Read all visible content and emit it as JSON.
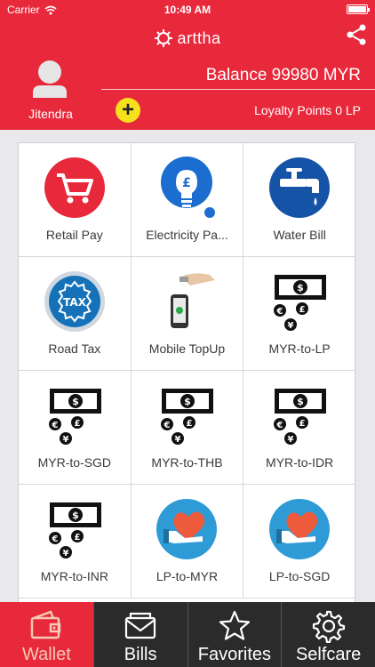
{
  "status_bar": {
    "carrier": "Carrier",
    "time": "10:49 AM"
  },
  "header": {
    "brand": "arttha",
    "user_name": "Jitendra",
    "balance": "Balance 99980 MYR",
    "loyalty": "Loyalty Points 0 LP",
    "add_label": "+"
  },
  "services": [
    {
      "label": "Retail Pay",
      "icon": "cart-icon"
    },
    {
      "label": "Electricity Pa...",
      "icon": "bulb-icon"
    },
    {
      "label": "Water Bill",
      "icon": "tap-icon"
    },
    {
      "label": "Road Tax",
      "icon": "tax-icon"
    },
    {
      "label": "Mobile TopUp",
      "icon": "phone-topup-icon"
    },
    {
      "label": "MYR-to-LP",
      "icon": "currency-exchange-icon"
    },
    {
      "label": "MYR-to-SGD",
      "icon": "currency-exchange-icon"
    },
    {
      "label": "MYR-to-THB",
      "icon": "currency-exchange-icon"
    },
    {
      "label": "MYR-to-IDR",
      "icon": "currency-exchange-icon"
    },
    {
      "label": "MYR-to-INR",
      "icon": "currency-exchange-icon"
    },
    {
      "label": "LP-to-MYR",
      "icon": "heart-hand-icon"
    },
    {
      "label": "LP-to-SGD",
      "icon": "heart-hand-icon"
    }
  ],
  "tabs": [
    {
      "label": "Wallet",
      "icon": "wallet-icon",
      "active": true
    },
    {
      "label": "Bills",
      "icon": "envelope-icon",
      "active": false
    },
    {
      "label": "Favorites",
      "icon": "star-icon",
      "active": false
    },
    {
      "label": "Selfcare",
      "icon": "gear-icon",
      "active": false
    }
  ],
  "colors": {
    "primary": "#e8283b",
    "accent": "#f5e21c",
    "tabbar": "#2b2b2b"
  }
}
